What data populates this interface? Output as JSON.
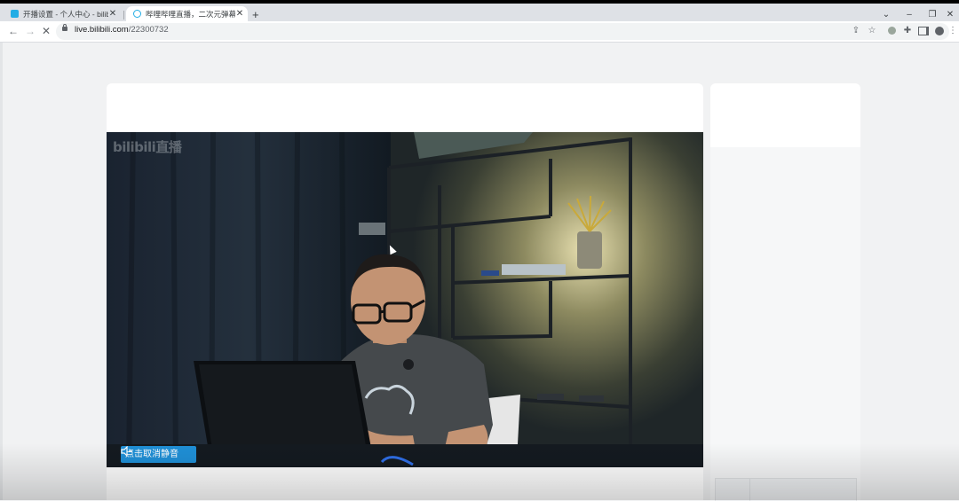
{
  "browser": {
    "tabs": [
      {
        "title": "开播设置 - 个人中心 - bilibili link",
        "favicon_color": "#23ade5",
        "active": false
      },
      {
        "title": "哔哩哔哩直播，二次元弹幕直播平台",
        "favicon_color": "#23ade5",
        "active": true
      }
    ],
    "new_tab_symbol": "+",
    "window_controls": {
      "menu": "⌄",
      "minimize": "–",
      "restore": "❐",
      "close": "✕"
    },
    "nav": {
      "back": "←",
      "forward": "→",
      "stop": "✕"
    },
    "address": {
      "host": "live.bilibili.com",
      "path": "/22300732"
    },
    "toolbar_icons": [
      "share-icon",
      "star-icon",
      "extension-circle-icon",
      "puzzle-icon",
      "sidepanel-icon",
      "profile-icon",
      "more-icon"
    ]
  },
  "player": {
    "watermark": "bilibili直播",
    "unmute_label": "点击取消静音"
  },
  "colors": {
    "accent": "#1f8fd6",
    "page_bg": "#f1f2f3"
  }
}
